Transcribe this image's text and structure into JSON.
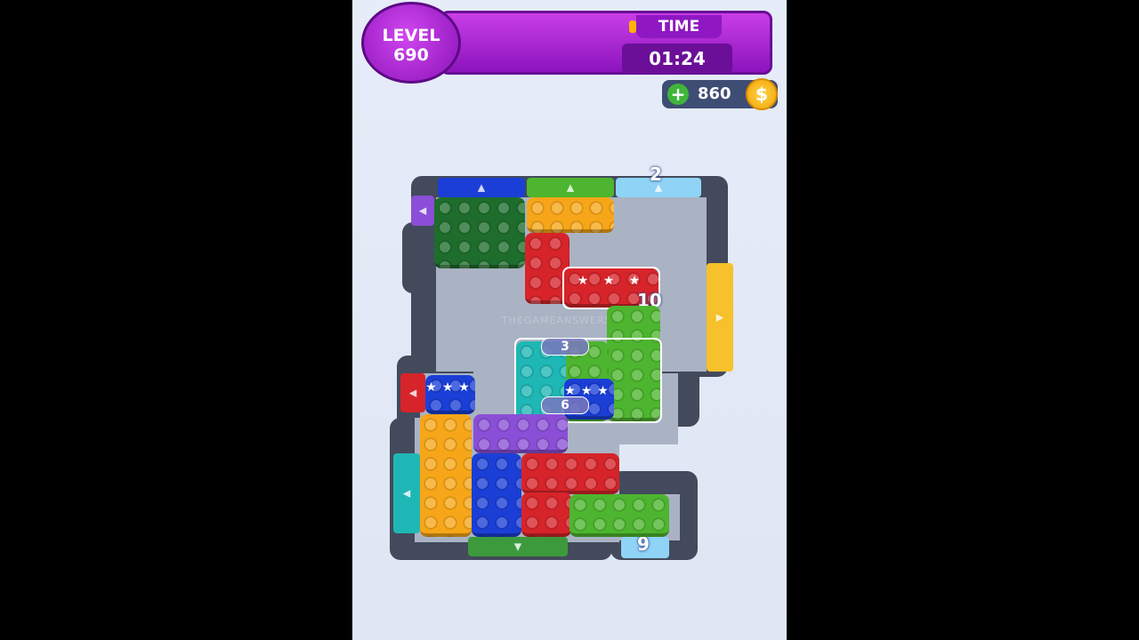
{
  "hud": {
    "level_label": "LEVEL",
    "level_number": "690",
    "time_label": "TIME",
    "time_value": "01:24",
    "restart_icon": "restart-icon",
    "coins_value": "860",
    "coin_plus_icon": "plus-icon",
    "coin_icon": "coin-icon",
    "coin_symbol": "$"
  },
  "board": {
    "top_gate_counter": "2",
    "bottom_gate_counter": "9",
    "lock_red": "10",
    "chain_top": "3",
    "chain_bottom": "6",
    "watermark": "THEGAMEANSWERS"
  },
  "colors": {
    "red": "#d6242a",
    "green": "#4db52f",
    "dark_green": "#1e6d2c",
    "blue": "#1b3fd6",
    "yellow": "#f6a618",
    "purple": "#8a4fd6",
    "teal": "#1fb7b5",
    "light_blue": "#8fd3f5"
  }
}
